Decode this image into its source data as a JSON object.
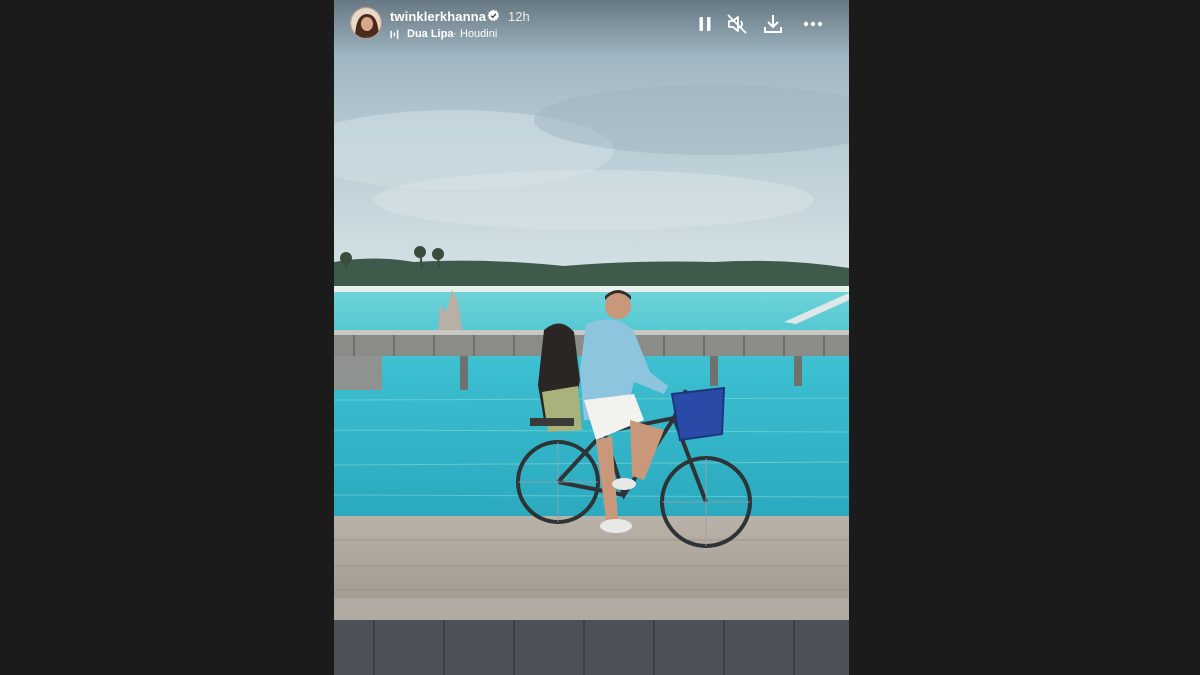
{
  "story": {
    "username": "twinklerkhanna",
    "verified": true,
    "time_ago": "12h",
    "music": {
      "artist": "Dua Lipa",
      "separator": "·",
      "track": "Houdini"
    }
  },
  "controls": {
    "pause_icon": "pause-icon",
    "mute_icon": "muted-speaker-icon",
    "download_icon": "download-icon",
    "more_icon": "more-options-icon"
  },
  "colors": {
    "backdrop": "#1b1b1b",
    "sky": "#a9bfcb",
    "sea": "#44c3cf",
    "verified": "#ffffff"
  }
}
